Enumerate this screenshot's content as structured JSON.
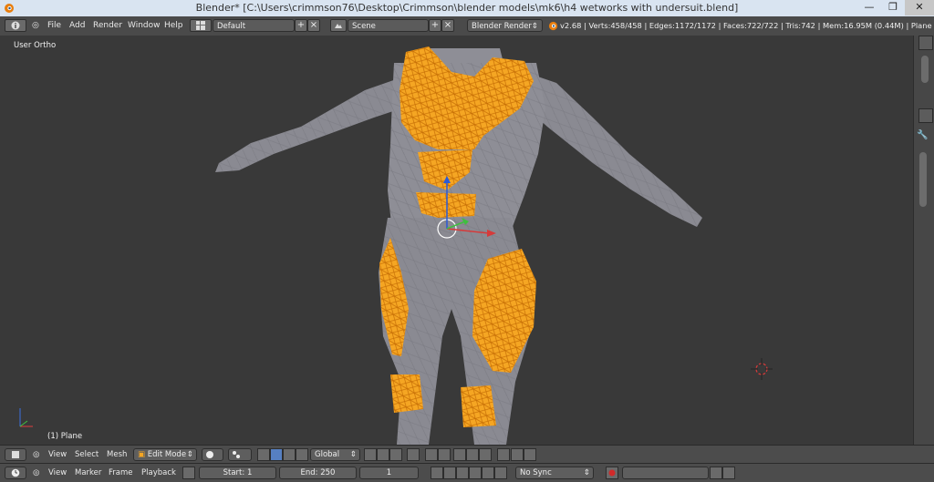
{
  "window": {
    "title": "Blender* [C:\\Users\\crimmson76\\Desktop\\Crimmson\\blender models\\mk6\\h4 wetworks with undersuit.blend]",
    "minimize": "—",
    "maximize": "❐",
    "close": "✕"
  },
  "info_header": {
    "menus": [
      "File",
      "Add",
      "Render",
      "Window",
      "Help"
    ],
    "layout": "Default",
    "scene": "Scene",
    "engine": "Blender Render",
    "stats": "v2.68 | Verts:458/458 | Edges:1172/1172 | Faces:722/722 | Tris:742 | Mem:16.95M (0.44M) | Plane"
  },
  "viewport": {
    "view_name": "User Ortho",
    "object_name": "(1) Plane"
  },
  "view3d_header": {
    "menus": [
      "View",
      "Select",
      "Mesh"
    ],
    "mode": "Edit Mode",
    "orientation": "Global"
  },
  "timeline_header": {
    "menus": [
      "View",
      "Marker",
      "Frame",
      "Playback"
    ],
    "start": "Start: 1",
    "end": "End: 250",
    "current_frame": "1",
    "sync": "No Sync"
  },
  "colors": {
    "selection": "#f5a623",
    "mesh": "#8e8e96",
    "background": "#393939",
    "header": "#4a4a4a"
  }
}
